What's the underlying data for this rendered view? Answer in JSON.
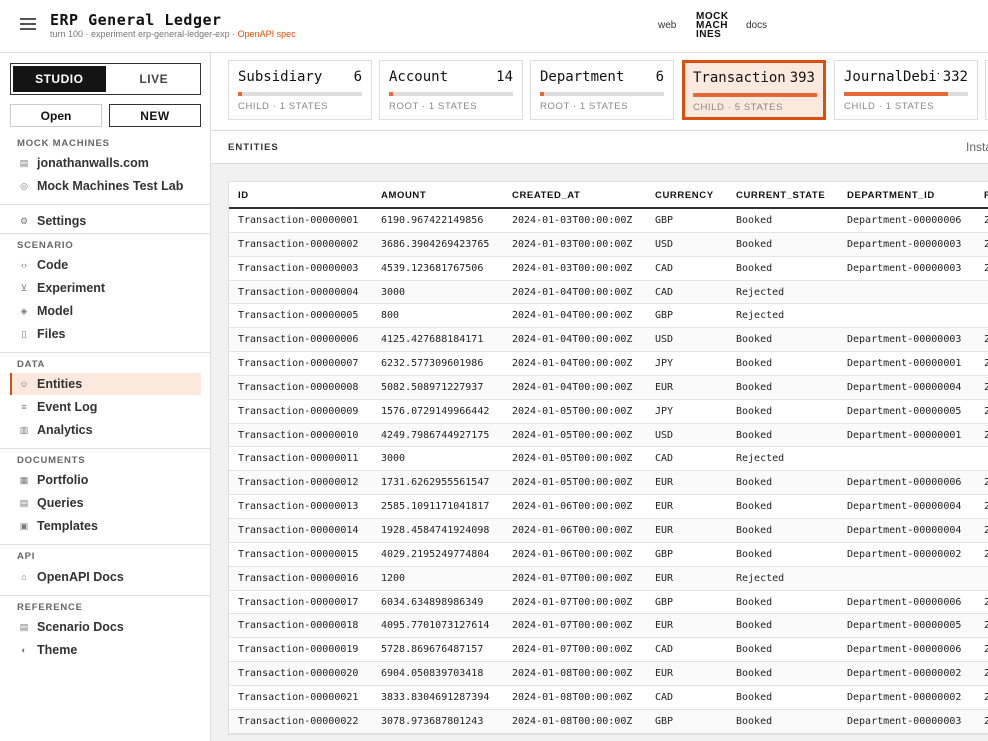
{
  "header": {
    "title": "ERP General Ledger",
    "subtitle_prefix": "turn 100 · experiment erp-general-ledger-exp ·",
    "subtitle_link": "OpenAPI spec",
    "nav_web": "web",
    "logo_line1": "MOCK",
    "logo_line2": "MACH",
    "logo_line3": "INES",
    "nav_docs": "docs"
  },
  "sidebar": {
    "toggle_studio": "STUDIO",
    "toggle_live": "LIVE",
    "open_label": "Open",
    "new_label": "NEW",
    "sections": {
      "mock_machines": "MOCK MACHINES",
      "scenario": "SCENARIO",
      "data": "DATA",
      "documents": "DOCUMENTS",
      "api": "API",
      "reference": "REFERENCE"
    },
    "items": {
      "jonathan": "jonathanwalls.com",
      "mock_lab": "Mock Machines Test Lab",
      "settings": "Settings",
      "code": "Code",
      "experiment": "Experiment",
      "model": "Model",
      "files": "Files",
      "entities": "Entities",
      "event_log": "Event Log",
      "analytics": "Analytics",
      "portfolio": "Portfolio",
      "queries": "Queries",
      "templates": "Templates",
      "openapi_docs": "OpenAPI Docs",
      "scenario_docs": "Scenario Docs",
      "theme": "Theme"
    }
  },
  "cards": [
    {
      "name": "Subsidiary",
      "count": "6",
      "meta": "CHILD · 1 STATES",
      "fill": 0.03
    },
    {
      "name": "Account",
      "count": "14",
      "meta": "ROOT · 1 STATES",
      "fill": 0.03
    },
    {
      "name": "Department",
      "count": "6",
      "meta": "ROOT · 1 STATES",
      "fill": 0.03
    },
    {
      "name": "Transaction",
      "count": "393",
      "meta": "CHILD · 5 STATES",
      "fill": 1.0
    },
    {
      "name": "JournalDebit",
      "count": "332",
      "meta": "CHILD · 1 STATES",
      "fill": 0.84
    }
  ],
  "entities_bar": {
    "label": "ENTITIES",
    "right_text": "Insta"
  },
  "table": {
    "columns": [
      "ID",
      "AMOUNT",
      "CREATED_AT",
      "CURRENCY",
      "CURRENT_STATE",
      "DEPARTMENT_ID",
      "P"
    ],
    "rows": [
      [
        "Transaction-00000001",
        "6190.967422149856",
        "2024-01-03T00:00:00Z",
        "GBP",
        "Booked",
        "Department-00000006",
        "2"
      ],
      [
        "Transaction-00000002",
        "3686.3904269423765",
        "2024-01-03T00:00:00Z",
        "USD",
        "Booked",
        "Department-00000003",
        "2"
      ],
      [
        "Transaction-00000003",
        "4539.123681767506",
        "2024-01-03T00:00:00Z",
        "CAD",
        "Booked",
        "Department-00000003",
        "2"
      ],
      [
        "Transaction-00000004",
        "3000",
        "2024-01-04T00:00:00Z",
        "CAD",
        "Rejected",
        "",
        ""
      ],
      [
        "Transaction-00000005",
        "800",
        "2024-01-04T00:00:00Z",
        "GBP",
        "Rejected",
        "",
        ""
      ],
      [
        "Transaction-00000006",
        "4125.427688184171",
        "2024-01-04T00:00:00Z",
        "USD",
        "Booked",
        "Department-00000003",
        "2"
      ],
      [
        "Transaction-00000007",
        "6232.577309601986",
        "2024-01-04T00:00:00Z",
        "JPY",
        "Booked",
        "Department-00000001",
        "2"
      ],
      [
        "Transaction-00000008",
        "5082.508971227937",
        "2024-01-04T00:00:00Z",
        "EUR",
        "Booked",
        "Department-00000004",
        "2"
      ],
      [
        "Transaction-00000009",
        "1576.0729149966442",
        "2024-01-05T00:00:00Z",
        "JPY",
        "Booked",
        "Department-00000005",
        "2"
      ],
      [
        "Transaction-00000010",
        "4249.7986744927175",
        "2024-01-05T00:00:00Z",
        "USD",
        "Booked",
        "Department-00000001",
        "2"
      ],
      [
        "Transaction-00000011",
        "3000",
        "2024-01-05T00:00:00Z",
        "CAD",
        "Rejected",
        "",
        ""
      ],
      [
        "Transaction-00000012",
        "1731.6262955561547",
        "2024-01-05T00:00:00Z",
        "EUR",
        "Booked",
        "Department-00000006",
        "2"
      ],
      [
        "Transaction-00000013",
        "2585.1091171041817",
        "2024-01-06T00:00:00Z",
        "EUR",
        "Booked",
        "Department-00000004",
        "2"
      ],
      [
        "Transaction-00000014",
        "1928.4584741924098",
        "2024-01-06T00:00:00Z",
        "EUR",
        "Booked",
        "Department-00000004",
        "2"
      ],
      [
        "Transaction-00000015",
        "4029.2195249774804",
        "2024-01-06T00:00:00Z",
        "GBP",
        "Booked",
        "Department-00000002",
        "2"
      ],
      [
        "Transaction-00000016",
        "1200",
        "2024-01-07T00:00:00Z",
        "EUR",
        "Rejected",
        "",
        ""
      ],
      [
        "Transaction-00000017",
        "6034.634898986349",
        "2024-01-07T00:00:00Z",
        "GBP",
        "Booked",
        "Department-00000006",
        "2"
      ],
      [
        "Transaction-00000018",
        "4095.7701073127614",
        "2024-01-07T00:00:00Z",
        "EUR",
        "Booked",
        "Department-00000005",
        "2"
      ],
      [
        "Transaction-00000019",
        "5728.869676487157",
        "2024-01-07T00:00:00Z",
        "CAD",
        "Booked",
        "Department-00000006",
        "2"
      ],
      [
        "Transaction-00000020",
        "6904.050839703418",
        "2024-01-08T00:00:00Z",
        "EUR",
        "Booked",
        "Department-00000002",
        "2"
      ],
      [
        "Transaction-00000021",
        "3833.8304691287394",
        "2024-01-08T00:00:00Z",
        "CAD",
        "Booked",
        "Department-00000002",
        "2"
      ],
      [
        "Transaction-00000022",
        "3078.973687801243",
        "2024-01-08T00:00:00Z",
        "GBP",
        "Booked",
        "Department-00000003",
        "2"
      ]
    ]
  },
  "colors": {
    "accent": "#d94f11",
    "accent_bg": "#fbe9de",
    "progress": "#e8683a"
  }
}
